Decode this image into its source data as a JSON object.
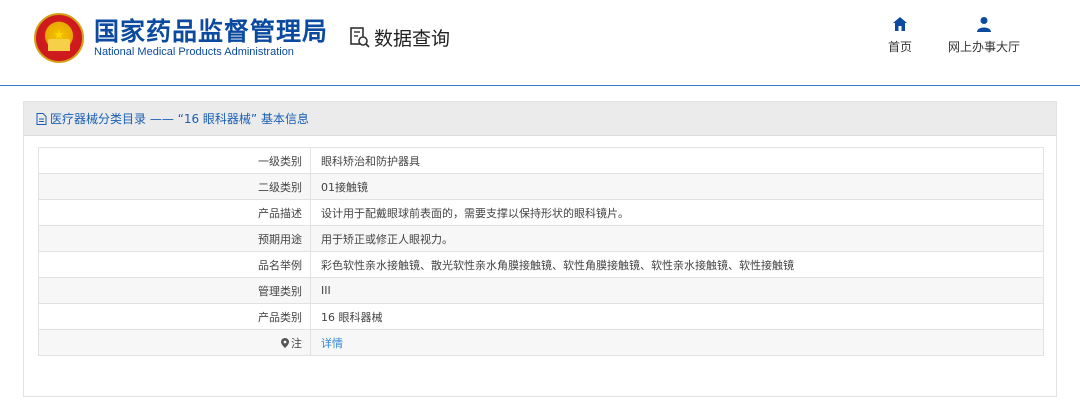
{
  "header": {
    "brand_cn": "国家药品监督管理局",
    "brand_en": "National Medical Products Administration",
    "section_title": "数据查询",
    "nav": [
      {
        "label": "首页",
        "icon": "home-icon"
      },
      {
        "label": "网上办事大厅",
        "icon": "user-icon"
      }
    ]
  },
  "panel": {
    "title": "医疗器械分类目录 —— “16 眼科器械” 基本信息",
    "rows": [
      {
        "label": "一级类别",
        "value": "眼科矫治和防护器具"
      },
      {
        "label": "二级类别",
        "value": "01接触镜"
      },
      {
        "label": "产品描述",
        "value": "设计用于配戴眼球前表面的，需要支撑以保持形状的眼科镜片。"
      },
      {
        "label": "预期用途",
        "value": "用于矫正或修正人眼视力。"
      },
      {
        "label": "品名举例",
        "value": "彩色软性亲水接触镜、散光软性亲水角膜接触镜、软性角膜接触镜、软性亲水接触镜、软性接触镜"
      },
      {
        "label": "管理类别",
        "value": "III"
      },
      {
        "label": "产品类别",
        "value": "16 眼科器械"
      }
    ],
    "note_label": "注",
    "note_link": "详情"
  },
  "colors": {
    "brand": "#0b4a9e",
    "link": "#2f86d6",
    "header_rule": "#3a7bc8"
  }
}
